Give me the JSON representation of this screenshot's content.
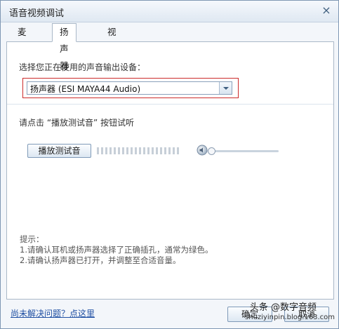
{
  "window": {
    "title": "语音视频调试",
    "close_label": "×"
  },
  "tabs": [
    {
      "label": "麦克风",
      "active": false
    },
    {
      "label": "扬声器",
      "active": true
    },
    {
      "label": "视频",
      "active": false
    }
  ],
  "output_device": {
    "prompt": "选择您正在使用的声音输出设备：",
    "selected": "扬声器 (ESI MAYA44 Audio)"
  },
  "test": {
    "instruction": "请点击 “播放测试音” 按钮试听",
    "play_button": "播放测试音",
    "level_bars": 20,
    "volume_level": 0
  },
  "tips": {
    "title": "提示：",
    "line1": "1.请确认耳机或扬声器选择了正确插孔，通常为绿色。",
    "line2": "2.请确认扬声器已打开，并调整至合适音量。"
  },
  "footer": {
    "help_link": "尚未解决问题？点这里",
    "ok": "确定",
    "cancel": "取消"
  },
  "watermark": {
    "line1": "头条 @数字音频",
    "line2": "shuziyinpin.blog.163.com"
  },
  "colors": {
    "highlight": "#cc2b2b",
    "link": "#1f4fa3",
    "window_border": "#7f97b3"
  }
}
